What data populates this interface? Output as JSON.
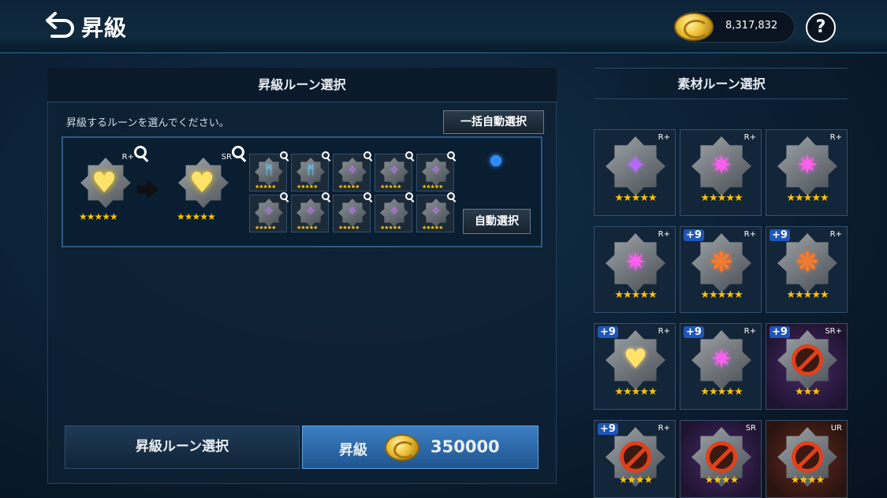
{
  "header": {
    "title": "昇級",
    "coins": "8,317,832",
    "help_label": "?"
  },
  "left_panel": {
    "title": "昇級ルーン選択",
    "instruction": "昇級するルーンを選んでください。",
    "auto_select_all_label": "一括自動選択",
    "auto_select_label": "自動選択",
    "current_rune": {
      "grade": "R+",
      "stars": "★★★★★"
    },
    "target_rune": {
      "grade": "SR",
      "stars": "★★★★★"
    },
    "material_slots": [
      {
        "glyph": "ᛗ",
        "color": "#6fd2ff"
      },
      {
        "glyph": "ᛗ",
        "color": "#6fd2ff"
      },
      {
        "glyph": "✧",
        "color": "#c77bff"
      },
      {
        "glyph": "✧",
        "color": "#c77bff"
      },
      {
        "glyph": "✧",
        "color": "#c77bff"
      },
      {
        "glyph": "✧",
        "color": "#c77bff"
      },
      {
        "glyph": "✧",
        "color": "#c77bff"
      },
      {
        "glyph": "✧",
        "color": "#c77bff"
      },
      {
        "glyph": "✧",
        "color": "#c77bff"
      },
      {
        "glyph": "✧",
        "color": "#c77bff"
      }
    ],
    "slot_stars": "★★★★★",
    "select_button_label": "昇級ルーン選択",
    "upgrade_button_label": "昇級",
    "upgrade_cost": "350000"
  },
  "right_panel": {
    "title": "素材ルーン選択",
    "cards": [
      {
        "grade": "R+",
        "plus": "",
        "gem": "✦",
        "gem_color": "#b56bff",
        "stars": "★★★★★",
        "bg": ""
      },
      {
        "grade": "R+",
        "plus": "",
        "gem": "✷",
        "gem_color": "#ff5ff0",
        "stars": "★★★★★",
        "bg": ""
      },
      {
        "grade": "R+",
        "plus": "",
        "gem": "✷",
        "gem_color": "#ff5ff0",
        "stars": "★★★★★",
        "bg": ""
      },
      {
        "grade": "R+",
        "plus": "",
        "gem": "✷",
        "gem_color": "#ff5ff0",
        "stars": "★★★★★",
        "bg": ""
      },
      {
        "grade": "R+",
        "plus": "+9",
        "gem": "❋",
        "gem_color": "#ff7a2a",
        "stars": "★★★★★",
        "bg": ""
      },
      {
        "grade": "R+",
        "plus": "+9",
        "gem": "❋",
        "gem_color": "#ff7a2a",
        "stars": "★★★★★",
        "bg": ""
      },
      {
        "grade": "R+",
        "plus": "+9",
        "gem": "♥",
        "gem_color": "#ffe26a",
        "stars": "★★★★★",
        "bg": ""
      },
      {
        "grade": "R+",
        "plus": "+9",
        "gem": "✷",
        "gem_color": "#ff5ff0",
        "stars": "★★★★★",
        "bg": ""
      },
      {
        "grade": "SR+",
        "plus": "+9",
        "gem": "",
        "gem_color": "",
        "stars": "★★★",
        "bg": "purple"
      },
      {
        "grade": "R+",
        "plus": "+9",
        "gem": "",
        "gem_color": "",
        "stars": "★★★★",
        "bg": ""
      },
      {
        "grade": "SR",
        "plus": "",
        "gem": "",
        "gem_color": "",
        "stars": "★★★★",
        "bg": "purple"
      },
      {
        "grade": "UR",
        "plus": "",
        "gem": "",
        "gem_color": "",
        "stars": "★★★★",
        "bg": "red"
      }
    ]
  }
}
